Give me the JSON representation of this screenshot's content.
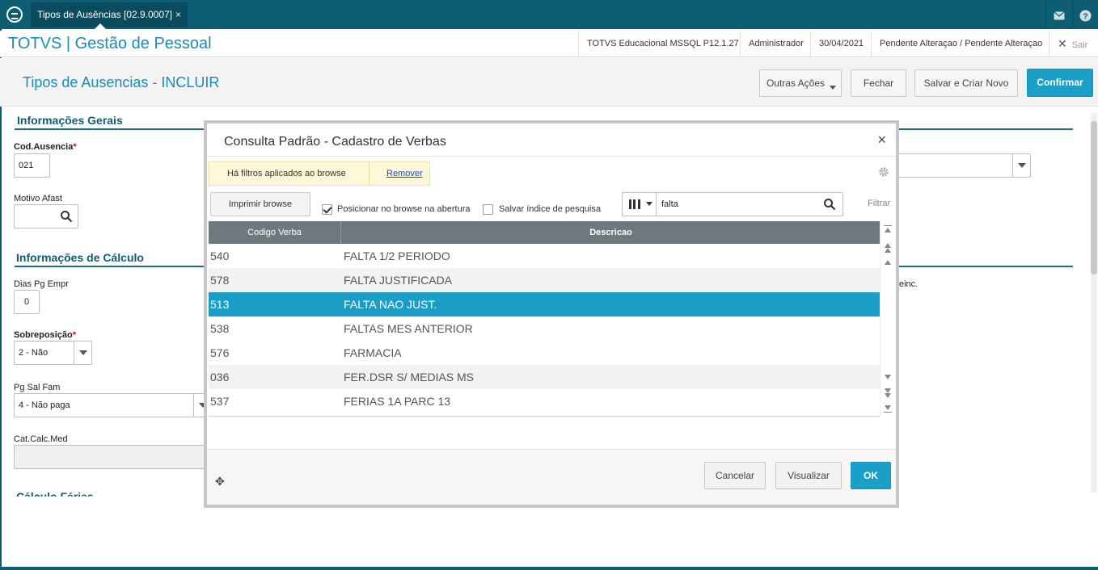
{
  "topbar": {
    "tab_label": "Tipos de Ausências [02.9.0007]",
    "tab_close": "×",
    "icons": [
      "logo-icon",
      "mail-icon",
      "help-icon"
    ]
  },
  "header": {
    "app_title": "TOTVS | Gestão de Pessoal",
    "environment": "TOTVS Educacional MSSQL P12.1.27",
    "user": "Administrador",
    "date": "30/04/2021",
    "status": "Pendente Alteraçao / Pendente Alteraçao",
    "exit_label": "Sair"
  },
  "actionbar": {
    "page_title": "Tipos de Ausencias - INCLUIR",
    "other_actions": "Outras Ações",
    "close": "Fechar",
    "save_new": "Salvar e Criar Novo",
    "confirm": "Confirmar"
  },
  "form": {
    "section_general": "Informações Gerais",
    "cod_label": "Cod.Ausencia",
    "required_mark": "*",
    "cod_value": "021",
    "motivo_label": "Motivo Afast",
    "motivo_value": "",
    "section_calc": "Informações de Cálculo",
    "dias_label": "Dias Pg Empr",
    "dias_value": "0",
    "sobre_label": "Sobreposição",
    "sobre_value": "2 - Não",
    "pgsal_label": "Pg Sal Fam",
    "pgsal_value": "4 - Não paga",
    "catcalc_label": "Cat.Calc.Med",
    "catcalc_value": "",
    "right_partial_label": "einc.",
    "section_ferias": "Cálculo Férias"
  },
  "modal": {
    "title": "Consulta Padrão - Cadastro de Verbas",
    "close": "×",
    "filter_note": "Há filtros aplicados ao browse",
    "filter_remove": "Remover",
    "print_button": "Imprimir browse",
    "chk_position_label": "Posicionar no browse na abertura",
    "chk_position_checked": true,
    "chk_save_label": "Salvar índice de pesquisa",
    "chk_save_checked": false,
    "search_value": "falta",
    "filter_label": "Filtrar",
    "columns": [
      "Codigo Verba",
      "Descricao"
    ],
    "rows": [
      {
        "code": "540",
        "desc": "FALTA 1/2 PERIODO"
      },
      {
        "code": "578",
        "desc": "FALTA JUSTIFICADA"
      },
      {
        "code": "513",
        "desc": "FALTA NAO JUST."
      },
      {
        "code": "538",
        "desc": "FALTAS MES ANTERIOR"
      },
      {
        "code": "576",
        "desc": "FARMACIA"
      },
      {
        "code": "036",
        "desc": "FER.DSR S/ MEDIAS MS"
      },
      {
        "code": "537",
        "desc": "FERIAS 1A PARC 13"
      }
    ],
    "selected_row": 2,
    "cancel": "Cancelar",
    "view": "Visualizar",
    "ok": "OK"
  },
  "colors": {
    "brand_dark": "#0d5d73",
    "accent": "#1aa0c8",
    "selected_row": "#1a9ec6"
  }
}
